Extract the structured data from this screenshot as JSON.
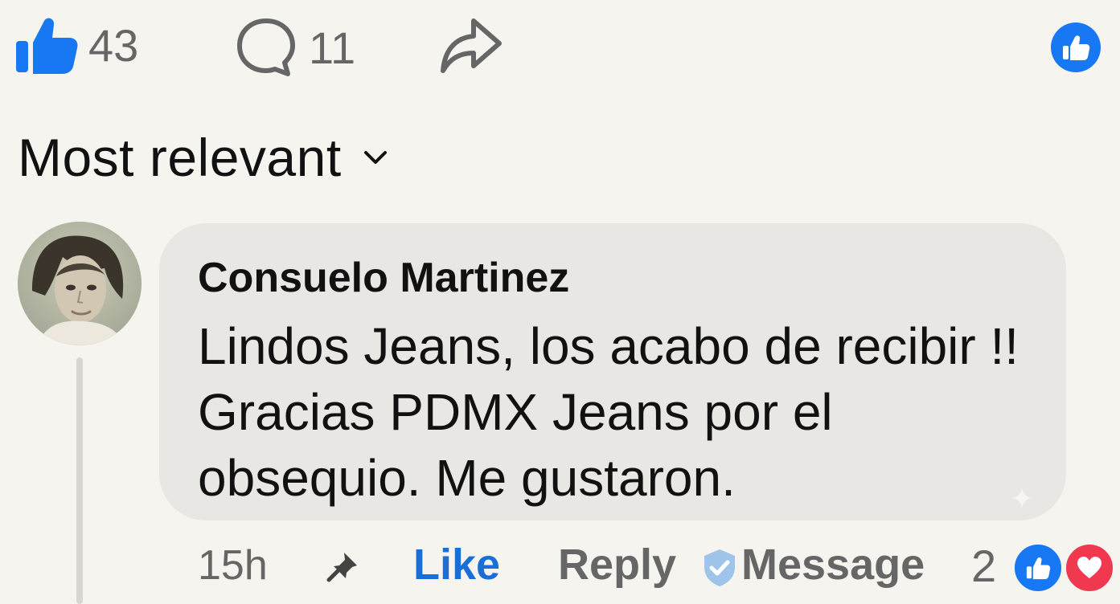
{
  "post_actions": {
    "like_count": "43",
    "comment_count": "11",
    "icons": {
      "like": "thumbs-up-icon",
      "comment": "comment-bubble-icon",
      "share": "share-arrow-icon",
      "reaction": "like-reaction-badge-icon"
    }
  },
  "sort": {
    "label": "Most relevant",
    "icon": "chevron-down-icon"
  },
  "comment": {
    "author": "Consuelo Martinez",
    "text": "Lindos Jeans, los acabo de recibir !! Gracias PDMX Jeans por el obsequio. Me gustaron.",
    "timestamp": "15h",
    "like_label": "Like",
    "reply_label": "Reply",
    "message_label": "Message",
    "reaction_count": "2",
    "icons": {
      "avatar": "avatar-photo",
      "pin": "pin-icon",
      "verified": "verified-shield-icon",
      "reactions": [
        "like-reaction-icon",
        "love-reaction-icon"
      ]
    }
  },
  "colors": {
    "background": "#f6f4ef",
    "facebook_blue": "#1877f2",
    "like_link": "#1a6ed8",
    "love_red": "#f0384f",
    "bubble": "#e9e7e3",
    "muted_text": "#666666"
  }
}
